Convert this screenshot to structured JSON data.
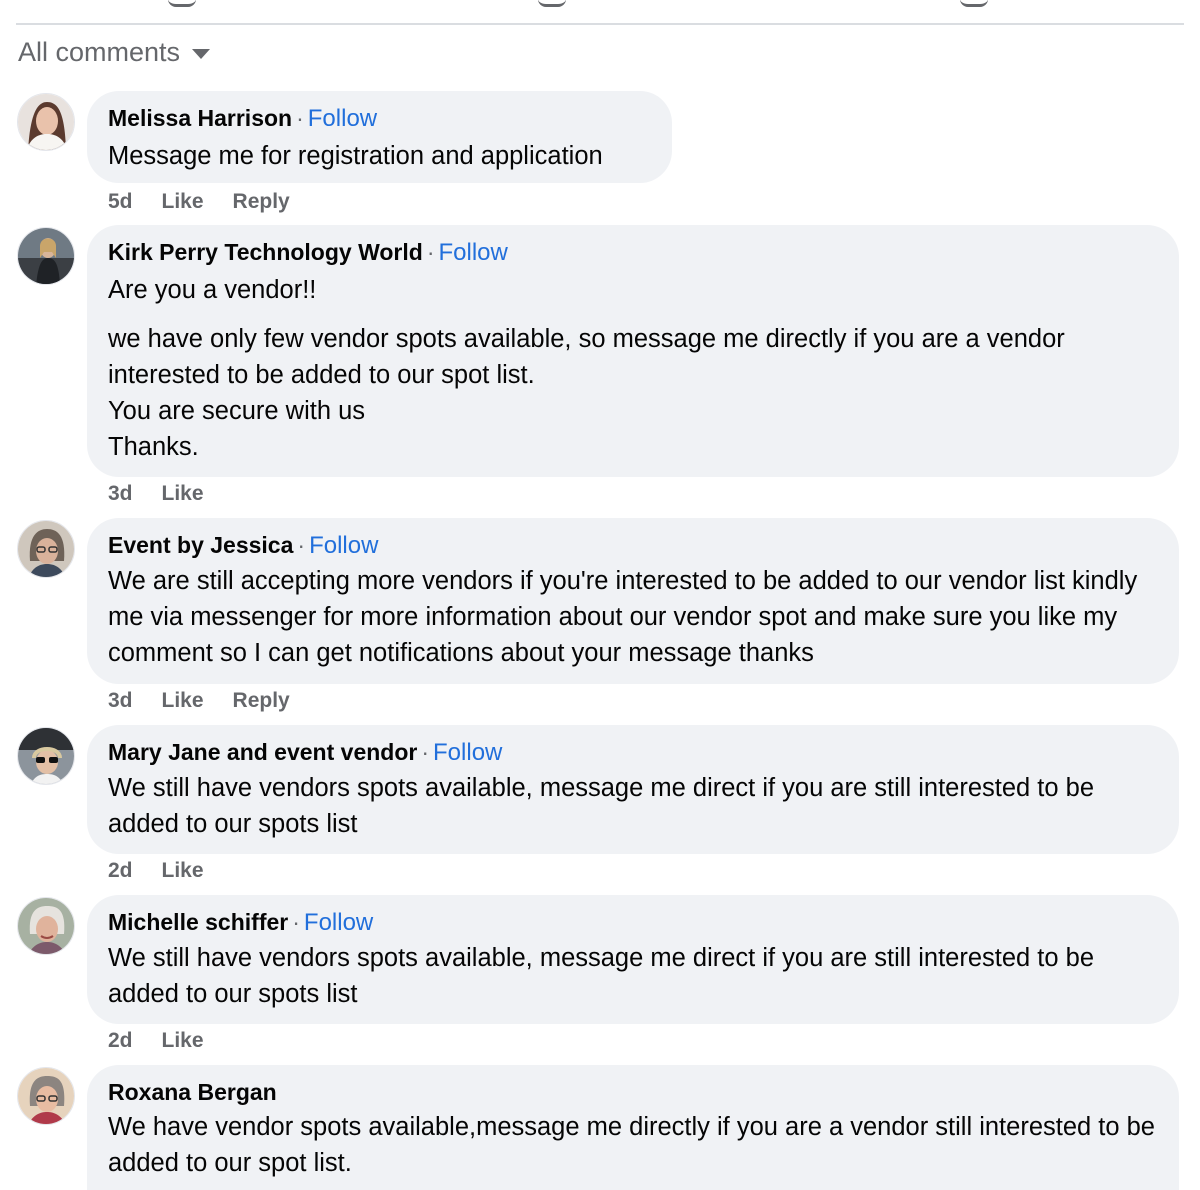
{
  "filter": {
    "label": "All comments"
  },
  "colors": {
    "follow": "#216fdb",
    "bubble": "#f0f2f5",
    "meta": "#65676b"
  },
  "comments": [
    {
      "author": "Melissa Harrison",
      "follow": "Follow",
      "paragraphs": [
        "Message me for registration and application"
      ],
      "time": "5d",
      "like": "Like",
      "reply": "Reply"
    },
    {
      "author": "Kirk Perry Technology World",
      "follow": "Follow",
      "paragraphs": [
        "Are you a vendor!!",
        "we have only few vendor spots available, so message me directly if you are a vendor interested to be added to our spot list.",
        "You are secure with us",
        "Thanks."
      ],
      "time": "3d",
      "like": "Like"
    },
    {
      "author": "Event by Jessica",
      "follow": "Follow",
      "paragraphs": [
        "We are still accepting more vendors if you're interested to be added to our vendor list kindly me via messenger for more information about our vendor spot and make sure you like my comment so I can get notifications about your message thanks"
      ],
      "time": "3d",
      "like": "Like",
      "reply": "Reply"
    },
    {
      "author": "Mary Jane and event vendor",
      "follow": "Follow",
      "paragraphs": [
        "We still have vendors spots available, message me direct if you are still interested to be added to our spots list"
      ],
      "time": "2d",
      "like": "Like"
    },
    {
      "author": "Michelle schiffer",
      "follow": "Follow",
      "paragraphs": [
        "We still have vendors spots available, message me direct if you are still interested to be added to our spots list"
      ],
      "time": "2d",
      "like": "Like"
    },
    {
      "author": "Roxana Bergan",
      "paragraphs": [
        "We have vendor spots available,message me directly if you are a vendor still interested to be added to our spot list."
      ]
    }
  ]
}
